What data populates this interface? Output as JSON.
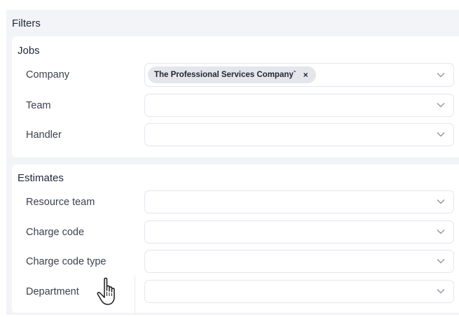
{
  "filters": {
    "title": "Filters",
    "jobs": {
      "title": "Jobs",
      "company": {
        "label": "Company",
        "selected_chip": "The Professional Services Company`",
        "chip_remove": "×"
      },
      "team": {
        "label": "Team"
      },
      "handler": {
        "label": "Handler"
      }
    },
    "estimates": {
      "title": "Estimates",
      "resource_team": {
        "label": "Resource team"
      },
      "charge_code": {
        "label": "Charge code"
      },
      "charge_code_type": {
        "label": "Charge code type"
      },
      "department": {
        "label": "Department"
      }
    }
  },
  "icons": {
    "dropdown": "chevron-down-icon",
    "cursor": "hand-pointer-icon"
  },
  "colors": {
    "panel_bg": "#f3f4f8",
    "chip_bg": "#e4e6ec",
    "border": "#e3e6ed"
  }
}
